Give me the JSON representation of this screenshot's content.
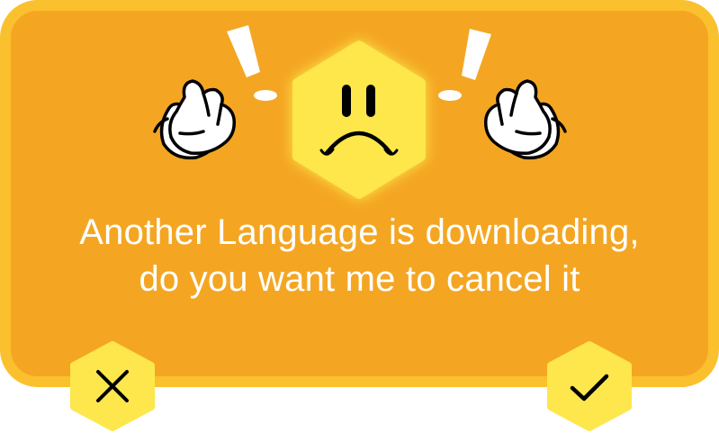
{
  "dialog": {
    "message_line1": "Another Language is downloading,",
    "message_line2": "do you want me to cancel it"
  },
  "icons": {
    "face": "sad-face-icon",
    "left_hands": "gesturing-hand-icon",
    "right_hands": "gesturing-hand-icon",
    "exclamations": "exclamation-icon",
    "cancel": "close-x-icon",
    "confirm": "checkmark-icon"
  },
  "colors": {
    "panel": "#f4a623",
    "panel_border": "#fbc02d",
    "hexagon": "#fde74c",
    "text": "#ffffff",
    "icon_stroke": "#000000"
  }
}
